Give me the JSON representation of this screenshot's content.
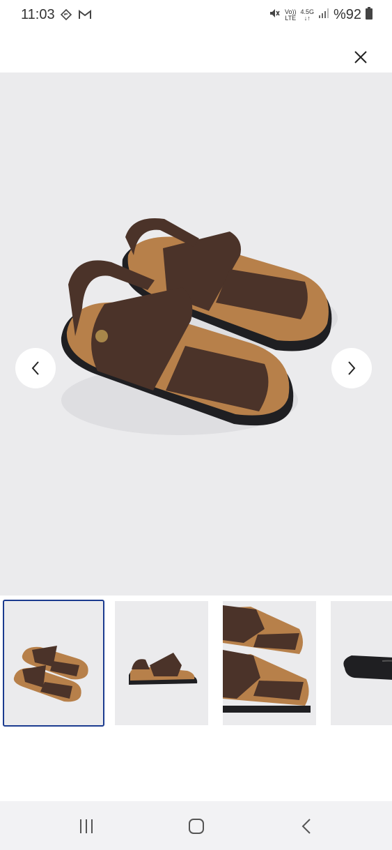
{
  "status_bar": {
    "time": "11:03",
    "left_icons": [
      "navigation-icon",
      "gmail-icon"
    ],
    "volte": "Vo)) LTE",
    "volte_top": "Vo))",
    "volte_bottom": "LTE",
    "network": "4.5G",
    "battery": "%92",
    "right_icons": [
      "mute-icon",
      "signal-icon",
      "battery-icon"
    ]
  },
  "header": {
    "close_icon": "close-icon"
  },
  "gallery": {
    "main_image": "brown leather strap sandals on light gray background",
    "prev_icon": "chevron-left-icon",
    "next_icon": "chevron-right-icon",
    "selected_index": 0,
    "thumbnails": [
      {
        "content": "pair of brown sandals, angled view"
      },
      {
        "content": "single brown sandal, side view"
      },
      {
        "content": "close-up of brown sandals straps"
      },
      {
        "content": "sandal sole, bottom view"
      }
    ]
  },
  "system_nav": {
    "items": [
      "recent-apps-icon",
      "home-icon",
      "back-icon"
    ]
  },
  "colors": {
    "image_bg": "#ebebed",
    "leather": "#4b3329",
    "footbed": "#b7804a",
    "sole": "#1f1f22",
    "selected_border": "#1b3b8f"
  }
}
